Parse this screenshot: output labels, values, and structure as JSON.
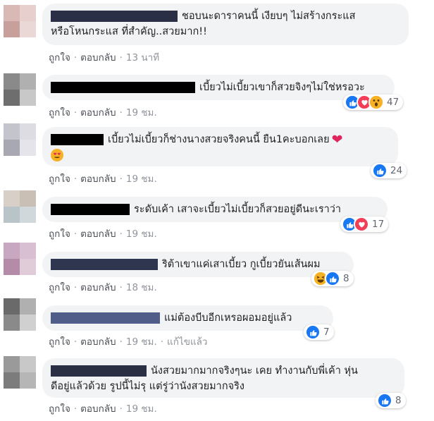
{
  "comments": [
    {
      "text": "ชอบนะดาราคนนี้ เงียบๆ ไม่สร้างกระแส",
      "text2": "หรือโหนกระแส ที่สำคัญ..สวยมาก!!",
      "like": "ถูกใจ",
      "reply": "ตอบกลับ",
      "time": "13 นาที",
      "reactions": []
    },
    {
      "text": "เบี้ยวไม่เบี้ยวเขาก็สวยจิงๆไม่ใช่หรอวะ",
      "like": "ถูกใจ",
      "reply": "ตอบกลับ",
      "time": "19 ชม.",
      "reactions": [
        "like-icon",
        "love-icon",
        "wow-icon"
      ],
      "count": "47"
    },
    {
      "text": "เบี้ยวไม่เบี้ยวก็ช่างนางสวยจริงคนนี้ ยืน1คะบอกเลย",
      "like": "ถูกใจ",
      "reply": "ตอบกลับ",
      "time": "19 ชม.",
      "reactions": [
        "like-icon"
      ],
      "count": "24"
    },
    {
      "text": "ระดับเค้า เสาจะเบี้ยวไม่เบี้ยวก็สวยอยู่ดีนะเราว่า",
      "like": "ถูกใจ",
      "reply": "ตอบกลับ",
      "time": "19 ชม.",
      "reactions": [
        "like-icon",
        "love-icon"
      ],
      "count": "17"
    },
    {
      "text": "ริต้าเขาแค่เสาเบี้ยว กูเบี้ยวยันเส้นผม",
      "like": "ถูกใจ",
      "reply": "ตอบกลับ",
      "time": "18 ชม.",
      "reactions": [
        "haha-icon",
        "like-icon"
      ],
      "count": "8"
    },
    {
      "text": "แม่ต้องบีบอีกเหรอผอมอยู่แล้ว",
      "like": "ถูกใจ",
      "reply": "ตอบกลับ",
      "time": "19 ชม.",
      "edited": "แก้ไขแล้ว",
      "reactions": [
        "like-icon"
      ],
      "count": "7"
    },
    {
      "text": "นังสวยมากมากจริงๆนะ เคย ทำงานกับพี่เค้า หุ่น",
      "text2": "ดีอยู่แล้วด้วย รูปนี้ไม่รุ แต่รู่ว่านังสวยมากจริง",
      "like": "ถูกใจ",
      "reply": "ตอบกลับ",
      "time": "19 ชม.",
      "reactions": [
        "like-icon"
      ],
      "count": "8"
    }
  ],
  "separator": "·",
  "colors": {
    "bubble": "#f2f3f5",
    "like": "#1877f2",
    "love": "#f33e58",
    "wow": "#f7b125",
    "meta": "#90949c"
  }
}
